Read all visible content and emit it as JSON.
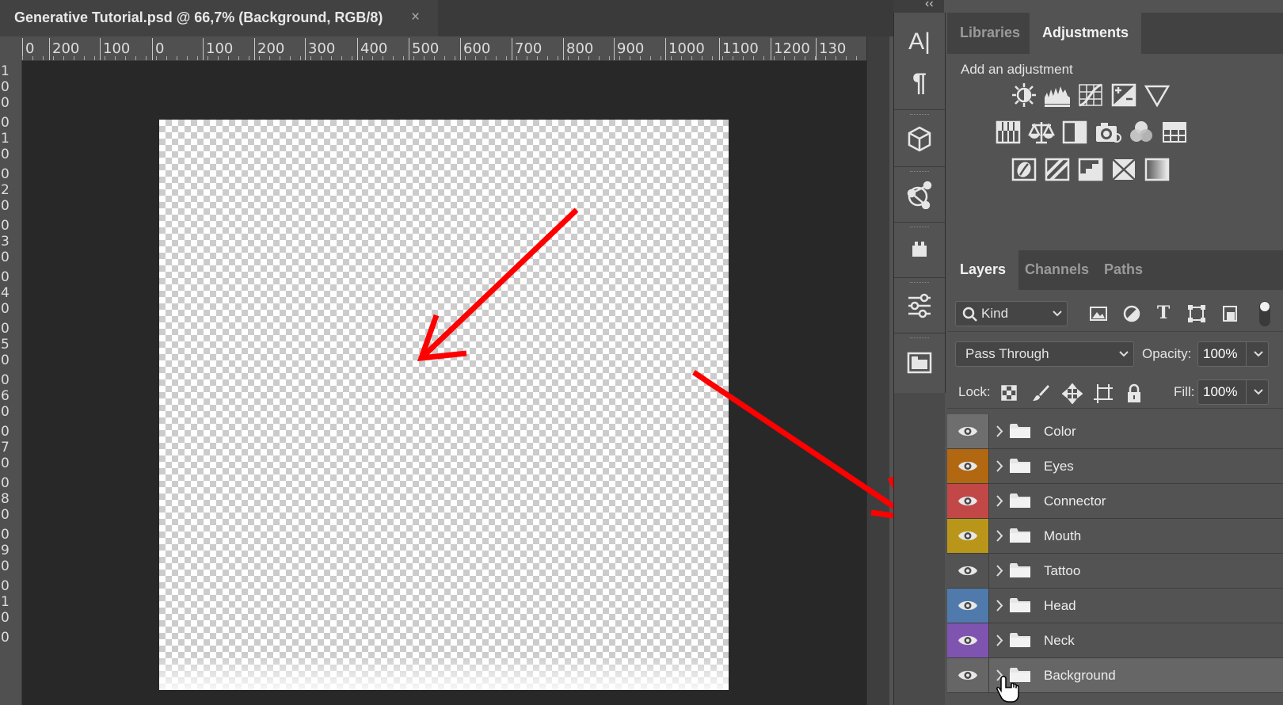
{
  "document": {
    "title": "Generative Tutorial.psd @ 66,7% (Background, RGB/8)",
    "close_symbol": "×",
    "zoom": "66,7%",
    "color_mode": "RGB/8"
  },
  "rulers": {
    "top_labels": [
      "0",
      "200",
      "100",
      "0",
      "100",
      "200",
      "300",
      "400",
      "500",
      "600",
      "700",
      "800",
      "900",
      "1000",
      "1100",
      "1200",
      "130"
    ],
    "left_labels": [
      "1",
      "0",
      "0",
      "0",
      "1",
      "0",
      "0",
      "2",
      "0",
      "0",
      "3",
      "0",
      "0",
      "4",
      "0",
      "0",
      "5",
      "0",
      "0",
      "6",
      "0",
      "0",
      "7",
      "0",
      "0",
      "8",
      "0",
      "0",
      "9",
      "0",
      "0",
      "1",
      "0",
      "0"
    ]
  },
  "dock": {
    "collapse_symbol": "‹‹",
    "icons": [
      "character-icon",
      "paragraph-icon",
      "3d-cube-icon",
      "share-network-icon",
      "plugins-icon",
      "properties-sliders-icon",
      "layer-comps-icon"
    ],
    "character_glyph": "A|",
    "paragraph_glyph": "¶"
  },
  "adjustments_panel": {
    "tabs": [
      "Libraries",
      "Adjustments"
    ],
    "active_tab": "Adjustments",
    "heading": "Add an adjustment",
    "icons": [
      [
        "brightness-contrast-icon",
        "levels-icon",
        "curves-icon",
        "exposure-icon",
        "vibrance-icon"
      ],
      [
        "hue-saturation-icon",
        "color-balance-icon",
        "black-white-icon",
        "photo-filter-icon",
        "channel-mixer-icon",
        "color-lookup-icon"
      ],
      [
        "invert-icon",
        "posterize-icon",
        "threshold-icon",
        "selective-color-icon",
        "gradient-map-icon"
      ]
    ]
  },
  "layers_panel": {
    "tabs": [
      "Layers",
      "Channels",
      "Paths"
    ],
    "active_tab": "Layers",
    "filter_kind": "Kind",
    "filter_icons": [
      "pixel-filter-icon",
      "adjustment-filter-icon",
      "type-filter-icon",
      "shape-filter-icon",
      "smart-object-filter-icon"
    ],
    "blend_mode": "Pass Through",
    "opacity_label": "Opacity:",
    "opacity_value": "100%",
    "lock_label": "Lock:",
    "fill_label": "Fill:",
    "fill_value": "100%",
    "lock_icons": [
      "lock-transparent-icon",
      "lock-image-icon",
      "lock-position-icon",
      "lock-artboard-icon",
      "lock-all-icon"
    ],
    "layers": [
      {
        "name": "Color",
        "color": "#6e6e6e",
        "selected": false
      },
      {
        "name": "Eyes",
        "color": "#b26711",
        "selected": false
      },
      {
        "name": "Connector",
        "color": "#c24848",
        "selected": false
      },
      {
        "name": "Mouth",
        "color": "#b9961a",
        "selected": false
      },
      {
        "name": "Tattoo",
        "color": "#535353",
        "selected": false
      },
      {
        "name": "Head",
        "color": "#4f7aab",
        "selected": false
      },
      {
        "name": "Neck",
        "color": "#7f54b0",
        "selected": false
      },
      {
        "name": "Background",
        "color": "#666666",
        "selected": true
      }
    ]
  },
  "annotation": {
    "arrow_color": "#ff0000"
  }
}
